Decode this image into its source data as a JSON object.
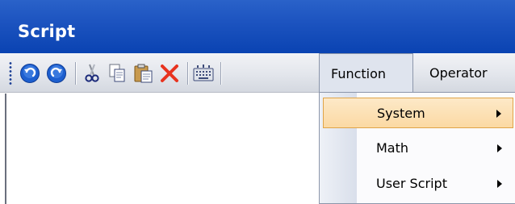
{
  "window": {
    "title": "Script"
  },
  "toolbar": {
    "buttons": [
      {
        "name": "undo-button",
        "icon": "undo-icon"
      },
      {
        "name": "redo-button",
        "icon": "redo-icon"
      },
      {
        "name": "cut-button",
        "icon": "scissors-icon"
      },
      {
        "name": "copy-button",
        "icon": "copy-icon"
      },
      {
        "name": "paste-button",
        "icon": "paste-icon"
      },
      {
        "name": "delete-button",
        "icon": "delete-icon"
      },
      {
        "name": "keyboard-button",
        "icon": "keyboard-icon"
      }
    ]
  },
  "menu": {
    "function_label": "Function",
    "operator_label": "Operator"
  },
  "dropdown": {
    "items": [
      {
        "label": "System",
        "selected": true,
        "has_submenu": true
      },
      {
        "label": "Math",
        "selected": false,
        "has_submenu": true
      },
      {
        "label": "User Script",
        "selected": false,
        "has_submenu": true
      }
    ]
  },
  "colors": {
    "titlebar": "#0a43b2",
    "selection_fill": "#fbd9a3",
    "selection_border": "#e0a447",
    "delete_red": "#e8331f",
    "nav_blue": "#1d5fcf"
  }
}
